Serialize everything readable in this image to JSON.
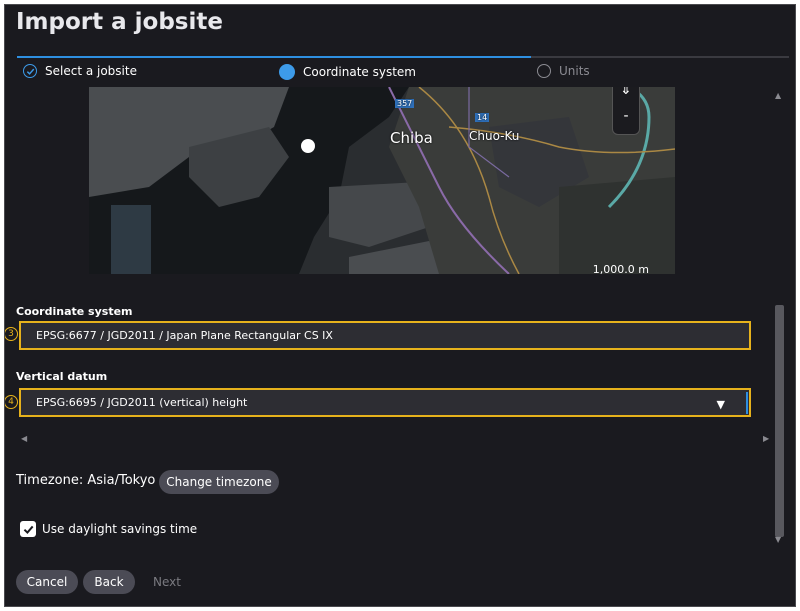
{
  "dialog": {
    "title": "Import a jobsite"
  },
  "steps": [
    {
      "label": "Select a jobsite",
      "state": "complete"
    },
    {
      "label": "Coordinate system",
      "state": "current"
    },
    {
      "label": "Units",
      "state": "pending"
    }
  ],
  "map": {
    "labels": {
      "city": "Chiba",
      "district": "Chuo-Ku",
      "route": "357",
      "road": "14"
    },
    "zoom_minus": "-",
    "scale": "1,000.0 m"
  },
  "coordinate_system": {
    "label": "Coordinate system",
    "value": "EPSG:6677 / JGD2011 / Japan Plane Rectangular CS IX",
    "marker": "3"
  },
  "vertical_datum": {
    "label": "Vertical datum",
    "value": "EPSG:6695 / JGD2011 (vertical) height",
    "marker": "4"
  },
  "timezone": {
    "text": "Timezone: Asia/Tokyo",
    "button": "Change timezone"
  },
  "daylight": {
    "label": "Use daylight savings time",
    "checked": true
  },
  "footer": {
    "cancel": "Cancel",
    "back": "Back",
    "next": "Next"
  },
  "colors": {
    "accent": "#2e8fe0",
    "highlight": "#e6b21c",
    "background": "#1a1a1f"
  }
}
